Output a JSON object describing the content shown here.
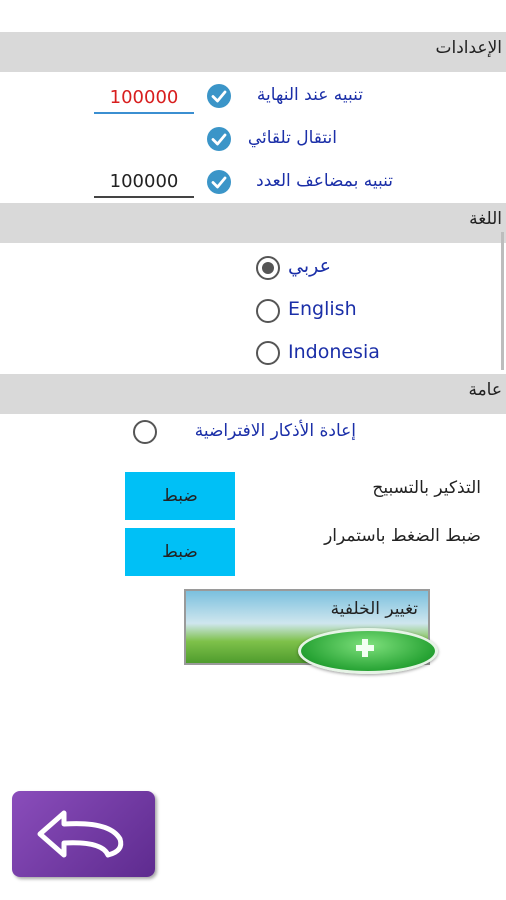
{
  "sections": {
    "settings": "الإعدادات",
    "language": "اللغة",
    "general": "عامة"
  },
  "settings": {
    "end_alert_label": "تنبيه عند النهاية",
    "end_alert_value": "100000",
    "auto_move_label": "انتقال تلقائي",
    "multiple_alert_label": "تنبيه بمضاعف العدد",
    "multiple_alert_value": "100000"
  },
  "language": {
    "options": [
      "عربي",
      "English",
      "Indonesia"
    ],
    "selected": "عربي"
  },
  "general": {
    "reset_label": "إعادة الأذكار الافتراضية",
    "reminder_label": "التذكير بالتسبيح",
    "reminder_button": "ضبط",
    "long_press_label": "ضبط الضغط باستمرار",
    "long_press_button": "ضبط",
    "change_bg_label": "تغيير الخلفية"
  },
  "colors": {
    "check_blue": "#3b95c8",
    "button_cyan": "#00c0f6",
    "label_blue": "#1b2fa8",
    "value_red": "#d81e1e",
    "back_purple": "#6b3399"
  },
  "icons": {
    "check": "check-circle-icon",
    "plus": "plus-icon",
    "back": "back-arrow-icon"
  }
}
